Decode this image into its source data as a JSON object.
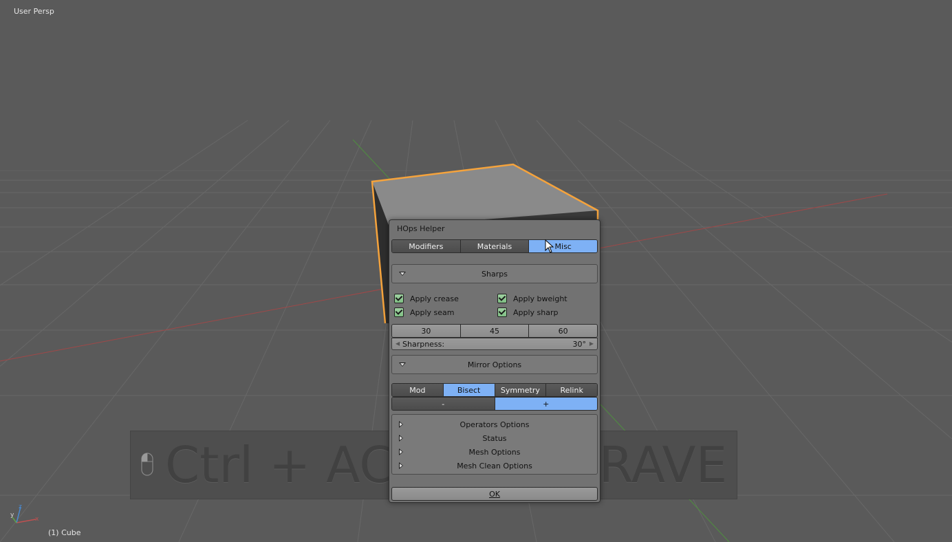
{
  "viewport": {
    "view_label": "User Persp",
    "object_label": "(1) Cube",
    "axis_labels": {
      "x": "x",
      "y": "y",
      "z": "z"
    }
  },
  "keystroke_overlay": {
    "text": "Ctrl + ACTION CARAVE",
    "icon": "mouse-icon"
  },
  "dialog": {
    "title": "HOps Helper",
    "tabs": [
      {
        "label": "Modifiers",
        "active": false
      },
      {
        "label": "Materials",
        "active": false
      },
      {
        "label": "Misc",
        "active": true
      }
    ],
    "sharps": {
      "header": "Sharps",
      "checkboxes": [
        {
          "label": "Apply crease",
          "checked": true
        },
        {
          "label": "Apply bweight",
          "checked": true
        },
        {
          "label": "Apply seam",
          "checked": true
        },
        {
          "label": "Apply sharp",
          "checked": true
        }
      ],
      "presets": [
        "30",
        "45",
        "60"
      ],
      "sharpness_label": "Sharpness:",
      "sharpness_value": "30°"
    },
    "mirror": {
      "header": "Mirror Options",
      "modes": [
        {
          "label": "Mod",
          "active": false
        },
        {
          "label": "Bisect",
          "active": true
        },
        {
          "label": "Symmetry",
          "active": false
        },
        {
          "label": "Relink",
          "active": false
        }
      ],
      "directions": [
        {
          "label": "-",
          "active": false
        },
        {
          "label": "+",
          "active": true
        }
      ]
    },
    "collapsed_panels": [
      "Operators Options",
      "Status",
      "Mesh Options",
      "Mesh Clean Options"
    ],
    "ok_label": "OK"
  },
  "colors": {
    "background": "#5a5a5a",
    "selection_outline": "#f5a33c",
    "active_button": "#7eb1f5",
    "grid_line": "#6a6a6a",
    "x_axis": "#b44a4a",
    "y_axis": "#5fa24a"
  }
}
